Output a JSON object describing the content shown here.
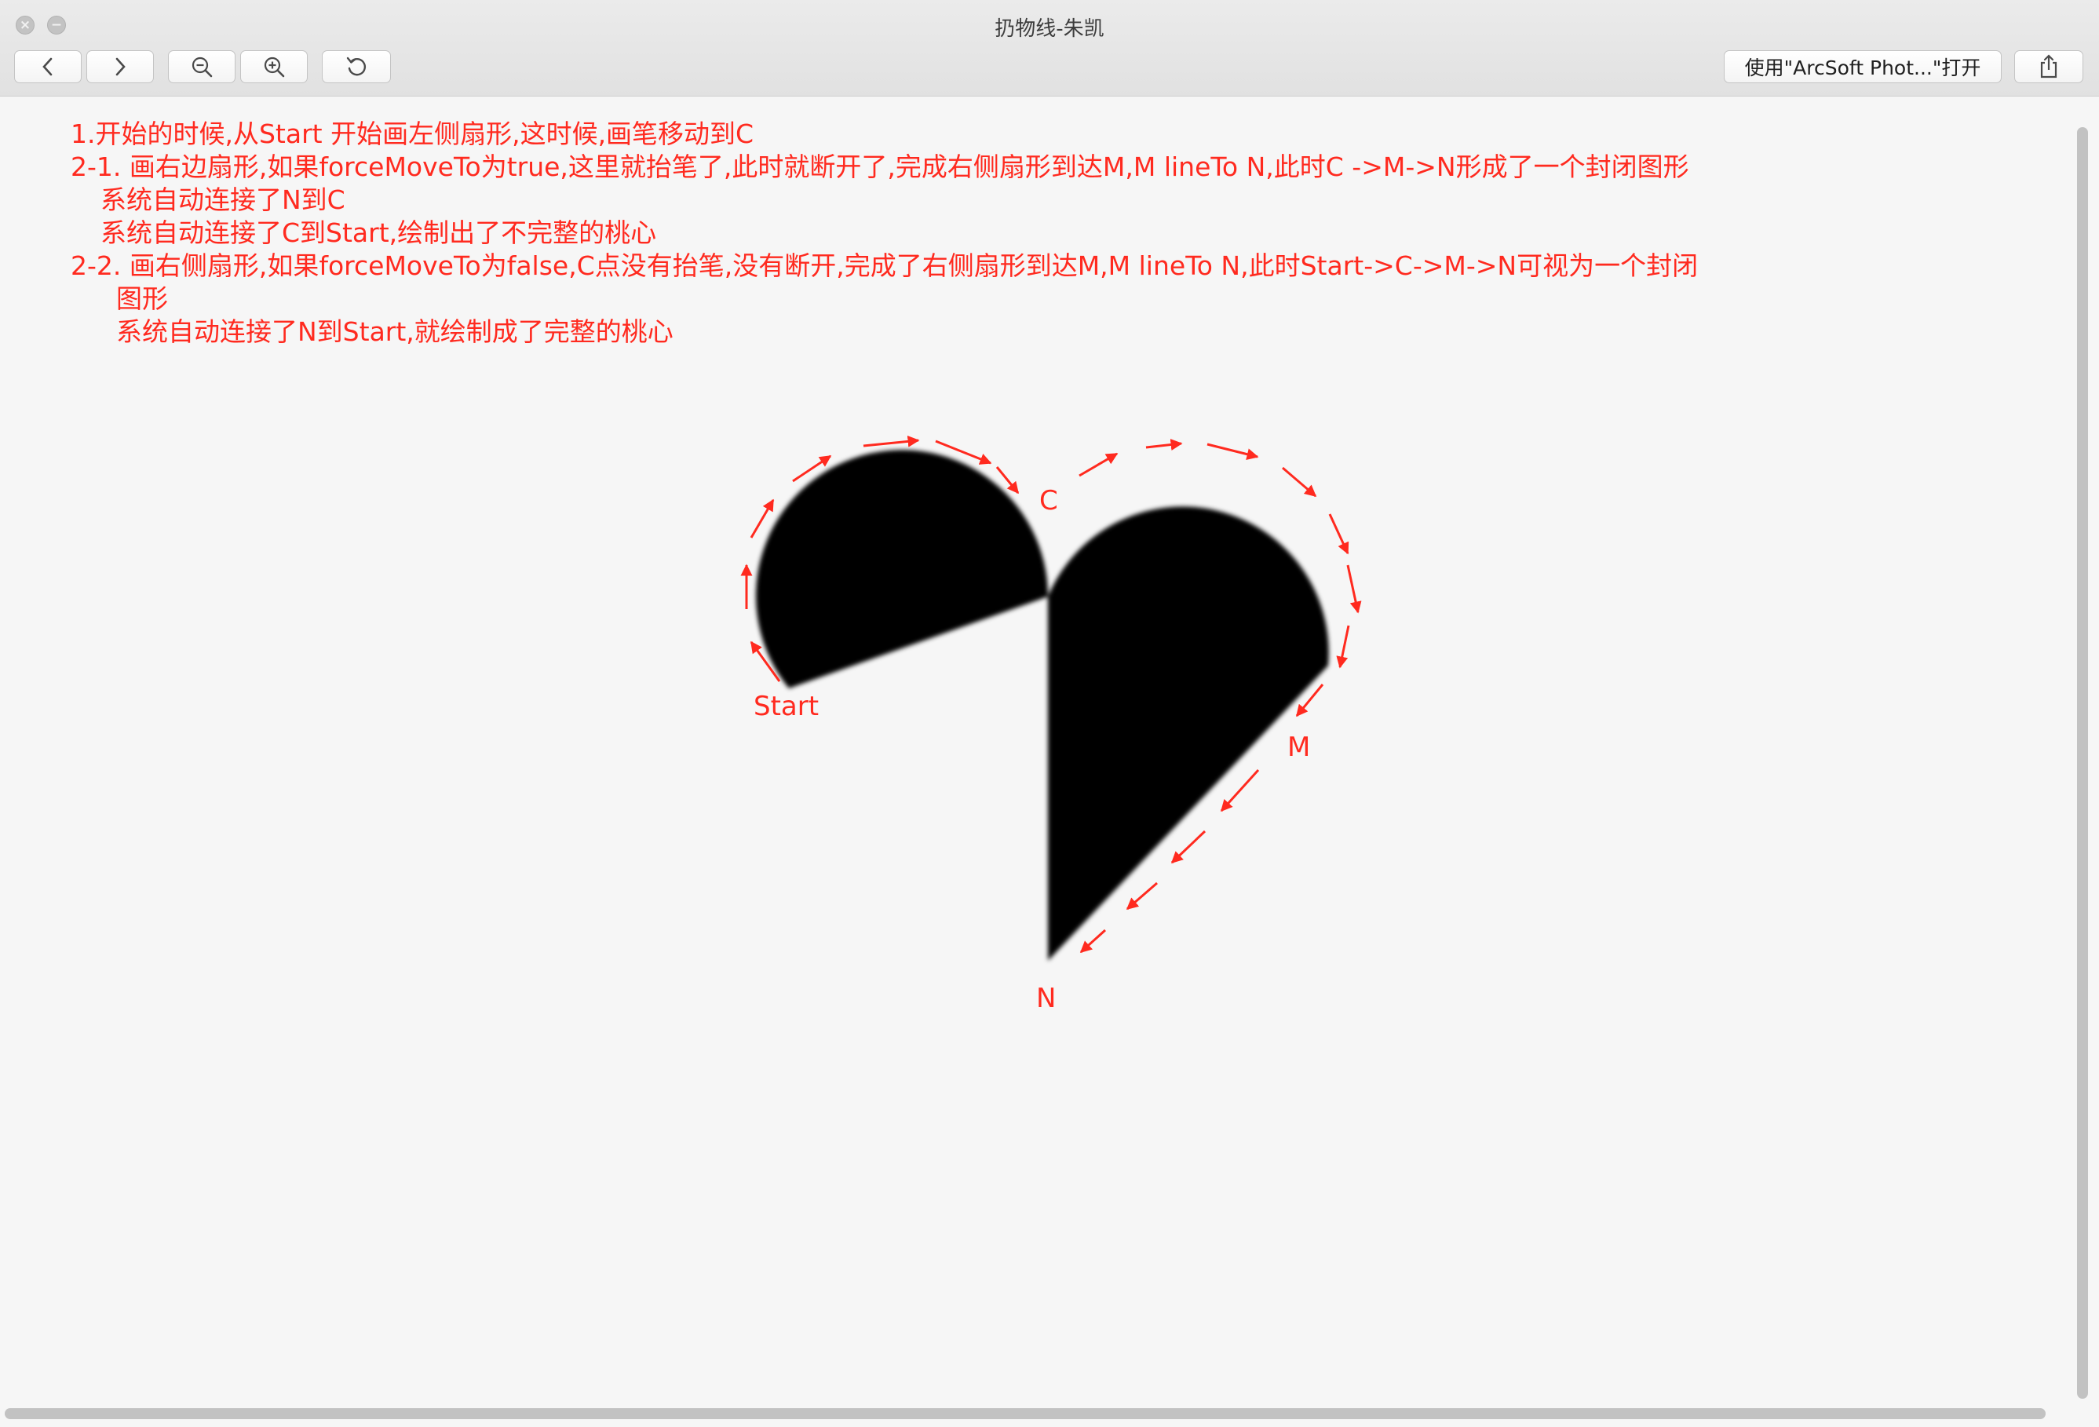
{
  "window": {
    "title": "扔物线-朱凯"
  },
  "toolbar": {
    "open_with_label": "使用\"ArcSoft Phot...\"打开"
  },
  "notes": [
    "1.开始的时候,从Start 开始画左侧扇形,这时候,画笔移动到C",
    "2-1. 画右边扇形,如果forceMoveTo为true,这里就抬笔了,此时就断开了,完成右侧扇形到达M,M lineTo N,此时C ->M->N形成了一个封闭图形",
    "系统自动连接了N到C",
    "系统自动连接了C到Start,绘制出了不完整的桃心",
    "2-2. 画右侧扇形,如果forceMoveTo为false,C点没有抬笔,没有断开,完成了右侧扇形到达M,M lineTo N,此时Start->C->M->N可视为一个封闭",
    "图形",
    "系统自动连接了N到Start,就绘制成了完整的桃心"
  ],
  "figure": {
    "labels": {
      "start": "Start",
      "c": "C",
      "m": "M",
      "n": "N"
    },
    "fill_color": "#000000",
    "annotation_color": "#ff2a1f"
  }
}
